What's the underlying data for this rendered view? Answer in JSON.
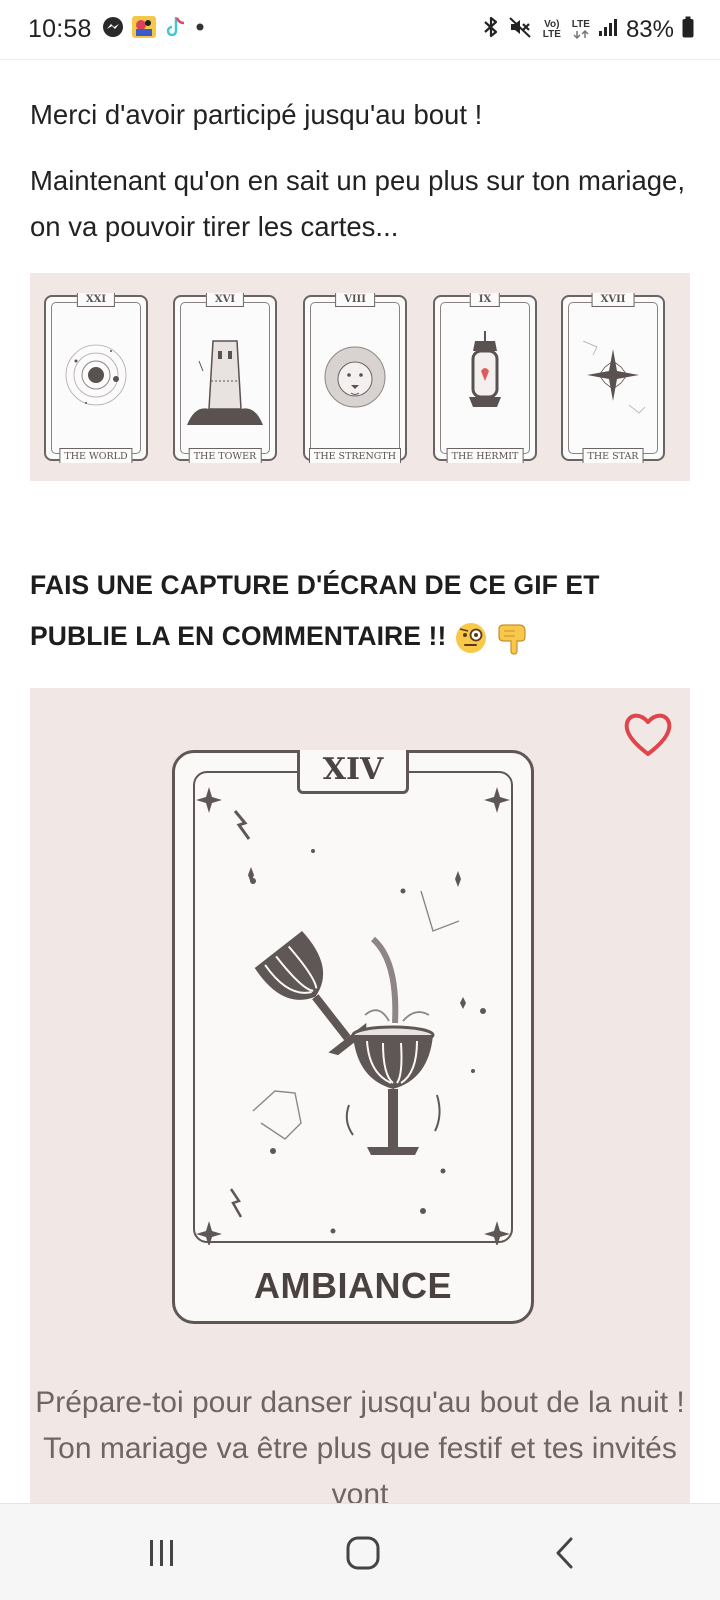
{
  "status_bar": {
    "time": "10:58",
    "notification_icons": [
      "messenger-icon",
      "app-avatar-icon",
      "tiktok-icon",
      "more-dot-icon"
    ],
    "system_icons": [
      "bluetooth-icon",
      "mute-icon",
      "volte-icon",
      "lte-icon",
      "signal-icon",
      "battery-icon"
    ],
    "volte_label": "Vo) LTE",
    "lte_label": "LTE",
    "battery_percent": "83%"
  },
  "article": {
    "paragraph_1": "Merci d'avoir participé jusqu'au bout !",
    "paragraph_2": "Maintenant qu'on en sait un peu plus sur ton mariage, on va pouvoir tirer les cartes...",
    "tarot_cards": [
      {
        "number": "XXI",
        "name": "THE WORLD"
      },
      {
        "number": "XVI",
        "name": "THE TOWER"
      },
      {
        "number": "VIII",
        "name": "THE STRENGTH"
      },
      {
        "number": "IX",
        "name": "THE HERMIT"
      },
      {
        "number": "XVII",
        "name": "THE STAR"
      }
    ],
    "heading": "FAIS UNE CAPTURE D'ÉCRAN DE CE GIF ET PUBLIE LA EN COMMENTAIRE !!",
    "heading_emojis": [
      "monocle-face-icon",
      "pointing-down-icon"
    ],
    "gif": {
      "card_number": "XIV",
      "card_name": "AMBIANCE",
      "caption": "Prépare-toi pour danser jusqu'au bout de la nuit ! Ton mariage va être plus que festif et tes invités vont"
    }
  },
  "colors": {
    "card_background": "#f1e8e6",
    "card_ink": "#5f5755",
    "heart": "#e0454c"
  },
  "nav_bar": {
    "buttons": [
      "recent-apps-icon",
      "home-icon",
      "back-icon"
    ]
  }
}
